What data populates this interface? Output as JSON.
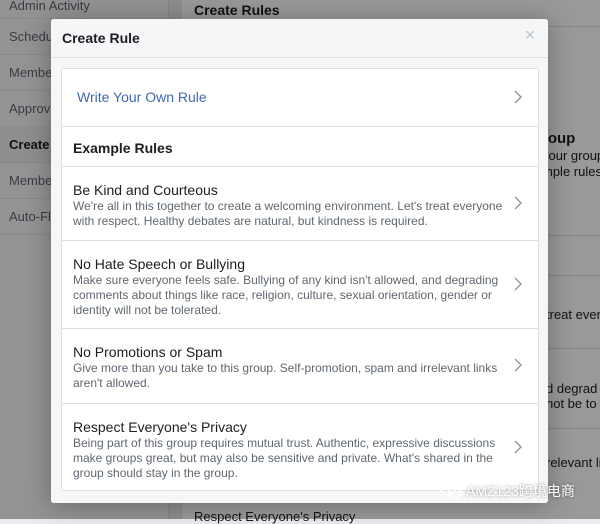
{
  "background": {
    "sidebar": [
      {
        "label": "Admin Activity"
      },
      {
        "label": "Schedu"
      },
      {
        "label": "Membe"
      },
      {
        "label": "Approv"
      },
      {
        "label": "Create R"
      },
      {
        "label": "Membe"
      },
      {
        "label": "Auto-Fl"
      }
    ],
    "header": "Create Rules",
    "fragments": {
      "group": "roup",
      "your_group": "your group",
      "ample_rules": "mple rules",
      "treat_every": "treat every",
      "degrad": "d degrad",
      "not_be_to": "not be to",
      "relevant_links": "relevant lin",
      "respect_privacy": "Respect Everyone's Privacy"
    }
  },
  "modal": {
    "title": "Create Rule",
    "close_glyph": "×",
    "write_own": "Write Your Own Rule",
    "section_title": "Example Rules",
    "rules": [
      {
        "title": "Be Kind and Courteous",
        "desc": "We're all in this together to create a welcoming environment. Let's treat everyone with respect. Healthy debates are natural, but kindness is required."
      },
      {
        "title": "No Hate Speech or Bullying",
        "desc": "Make sure everyone feels safe. Bullying of any kind isn't allowed, and degrading comments about things like race, religion, culture, sexual orientation, gender or identity will not be tolerated."
      },
      {
        "title": "No Promotions or Spam",
        "desc": "Give more than you take to this group. Self-promotion, spam and irrelevant links aren't allowed."
      },
      {
        "title": "Respect Everyone's Privacy",
        "desc": "Being part of this group requires mutual trust. Authentic, expressive discussions make groups great, but may also be sensitive and private. What's shared in the group should stay in the group."
      }
    ]
  },
  "watermark": {
    "text": "AMZ123跨境电商"
  },
  "colors": {
    "link": "#4267b2",
    "overlay": "rgba(0,0,0,0.40)",
    "muted_text": "#606770"
  }
}
